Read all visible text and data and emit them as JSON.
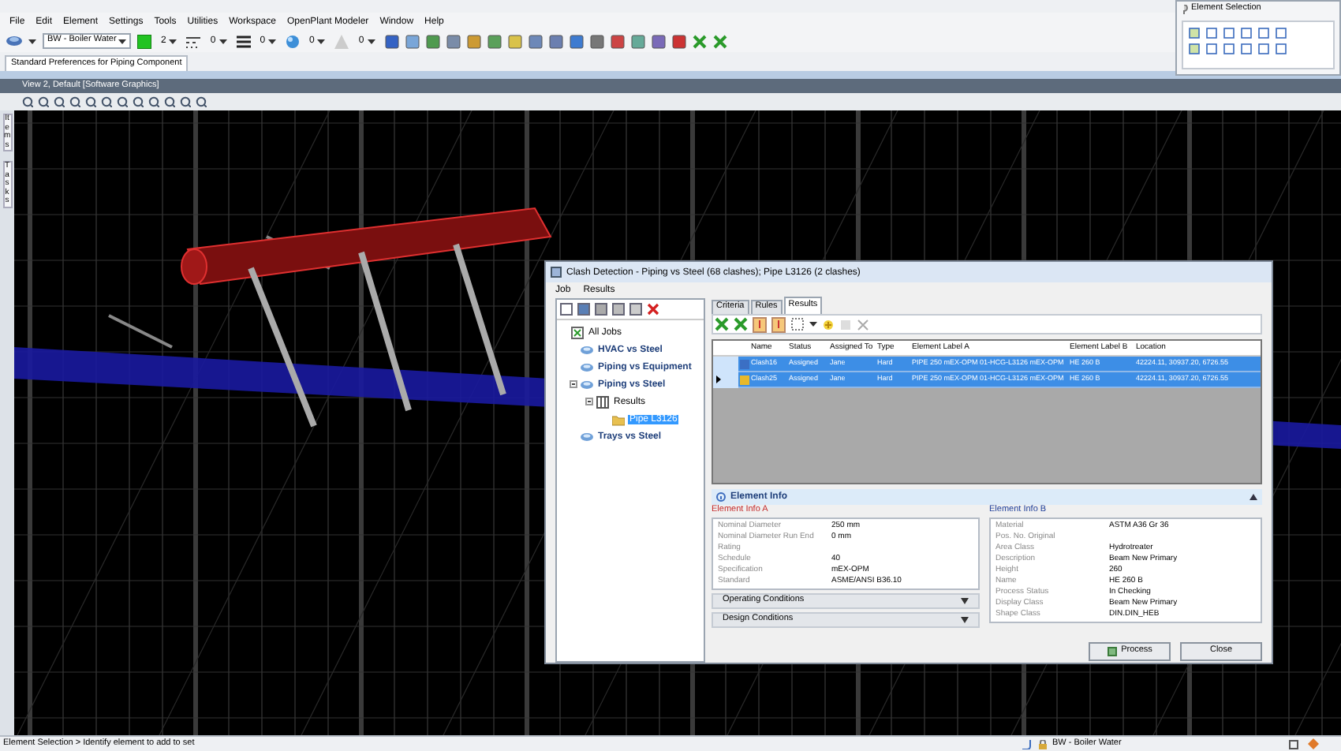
{
  "menu_bar": [
    "File",
    "Edit",
    "Element",
    "Settings",
    "Tools",
    "Utilities",
    "Workspace",
    "OpenPlant Modeler",
    "Window",
    "Help"
  ],
  "toolbar": {
    "level": "BW - Boiler Water",
    "color_value": "2",
    "style_value": "0",
    "weight_value": "0",
    "transparency_value": "0",
    "priority_value": "0"
  },
  "preferences_tab": "Standard Preferences for Piping Component",
  "element_selection_panel": {
    "title": "Element Selection"
  },
  "view_window": {
    "title": "View 2, Default [Software Graphics]",
    "side_tabs": [
      "Items",
      "Tasks"
    ]
  },
  "clash_dialog": {
    "title": "Clash Detection - Piping vs Steel (68 clashes); Pipe L3126 (2 clashes)",
    "menu": [
      "Job",
      "Results"
    ],
    "tree": [
      {
        "label": "All Jobs",
        "kind": "root",
        "selected": false,
        "children": [
          {
            "label": "HVAC vs Steel",
            "kind": "job",
            "selected": false
          },
          {
            "label": "Piping vs Equipment",
            "kind": "job",
            "selected": false
          },
          {
            "label": "Piping vs Steel",
            "kind": "job",
            "selected": false,
            "expanded": true,
            "children": [
              {
                "label": "Results",
                "kind": "results",
                "selected": false,
                "expanded": true,
                "children": [
                  {
                    "label": "Pipe L3126",
                    "kind": "pipe",
                    "selected": true
                  }
                ]
              }
            ]
          },
          {
            "label": "Trays vs Steel",
            "kind": "job",
            "selected": false
          }
        ]
      }
    ],
    "tabs": [
      {
        "label": "Criteria",
        "selected": false
      },
      {
        "label": "Rules",
        "selected": false
      },
      {
        "label": "Results",
        "selected": true
      }
    ],
    "table": {
      "columns": [
        "Name",
        "Status",
        "Assigned To",
        "Type",
        "Element Label A",
        "Element Label B",
        "Location"
      ],
      "rows": [
        {
          "cells": [
            "Clash16",
            "Assigned",
            "Jane",
            "Hard",
            "PIPE 250 mEX-OPM 01-HCG-L3126 mEX-OPM",
            "HE 260 B",
            "42224.11, 30937.20, 6726.55"
          ],
          "selected": true,
          "current": false,
          "color": "#3b6fc4"
        },
        {
          "cells": [
            "Clash25",
            "Assigned",
            "Jane",
            "Hard",
            "PIPE 250 mEX-OPM 01-HCG-L3126 mEX-OPM",
            "HE 260 B",
            "42224.11, 30937.20, 6726.55"
          ],
          "selected": true,
          "current": true,
          "color": "#e8b82a"
        }
      ]
    },
    "element_info": {
      "title": "Element Info",
      "expanded": true,
      "info_a": {
        "title": "Element Info A",
        "properties": [
          {
            "name": "Nominal Diameter",
            "value": "250 mm"
          },
          {
            "name": "Nominal Diameter Run End",
            "value": "0 mm"
          },
          {
            "name": "Rating"
          },
          {
            "name": "Schedule",
            "value": "40"
          },
          {
            "name": "Specification",
            "value": "mEX-OPM"
          },
          {
            "name": "Standard",
            "value": "ASME/ANSI B36.10"
          }
        ],
        "sections": [
          {
            "label": "Operating Conditions",
            "expanded": false
          },
          {
            "label": "Design Conditions",
            "expanded": false
          }
        ]
      },
      "info_b": {
        "title": "Element Info B",
        "properties": [
          {
            "name": "Material",
            "value": "ASTM A36 Gr 36"
          },
          {
            "name": "Pos. No. Original"
          },
          {
            "name": "Area Class",
            "value": "Hydrotreater"
          },
          {
            "name": "Description",
            "value": "Beam New Primary"
          },
          {
            "name": "Height",
            "value": "260"
          },
          {
            "name": "Name",
            "value": "HE 260 B"
          },
          {
            "name": "Process Status",
            "value": "In Checking"
          },
          {
            "name": "Display Class",
            "value": "Beam New Primary"
          },
          {
            "name": "Shape Class",
            "value": "DIN.DIN_HEB"
          }
        ]
      }
    },
    "buttons": [
      "Process",
      "Close"
    ]
  },
  "status_bar": {
    "prompt": "Element Selection > Identify element to add to set",
    "level": "BW - Boiler Water"
  }
}
